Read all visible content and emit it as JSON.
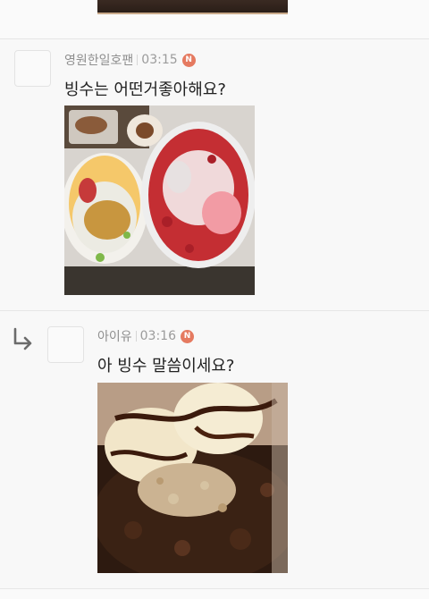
{
  "comments": [
    {
      "author": "영원한일호팬",
      "time": "03:15",
      "badge": "N",
      "text": "빙수는 어떤거좋아해요?"
    },
    {
      "author": "아이유",
      "time": "03:16",
      "badge": "N",
      "text": "아 빙수 말씀이세요?",
      "is_reply": true
    }
  ],
  "icons": {
    "reply": "reply-arrow-icon",
    "new": "new-badge-icon"
  },
  "colors": {
    "badge": "#e57a60",
    "meta_text": "#8f8f8f"
  }
}
